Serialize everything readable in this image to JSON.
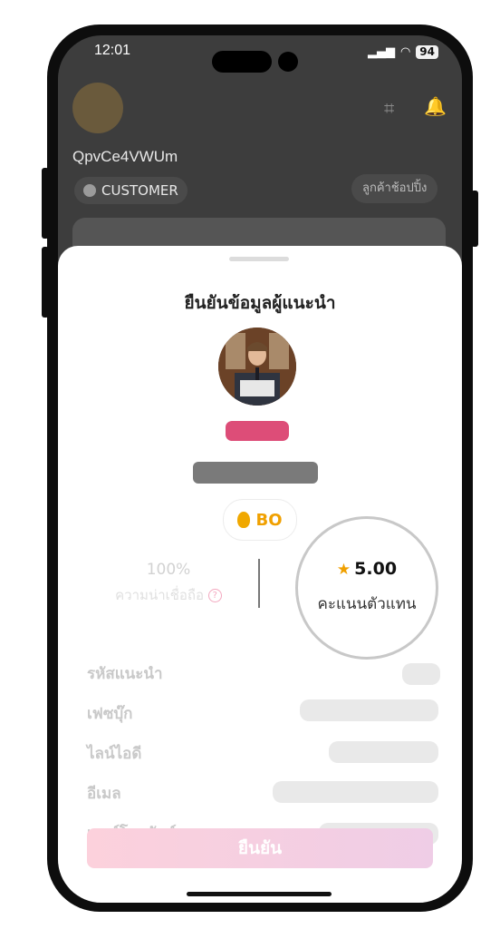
{
  "status_bar": {
    "time": "12:01",
    "battery": "94"
  },
  "background_profile": {
    "username": "QpvCe4VWUm",
    "role": "CUSTOMER",
    "scan_button": "ลูกค้าช้อปปิ้ง"
  },
  "sheet": {
    "title": "ยืนยันข้อมูลผู้แนะนำ",
    "badge": "BO",
    "reliability_value": "100%",
    "reliability_label": "ความน่าเชื่อถือ",
    "rating_value": "5.00",
    "rating_label": "คะแนนตัวแทน",
    "fields": [
      {
        "label": "รหัสแนะนำ"
      },
      {
        "label": "เฟซบุ๊ก"
      },
      {
        "label": "ไลน์ไอดี"
      },
      {
        "label": "อีเมล"
      },
      {
        "label": "เบอร์โทรศัพท์"
      }
    ],
    "confirm_label": "ยืนยัน"
  },
  "colors": {
    "accent_pink": "#dd4d78",
    "gold": "#f0a000",
    "confirm_gradient_start": "#fcd1dc",
    "confirm_gradient_end": "#efcde6"
  }
}
